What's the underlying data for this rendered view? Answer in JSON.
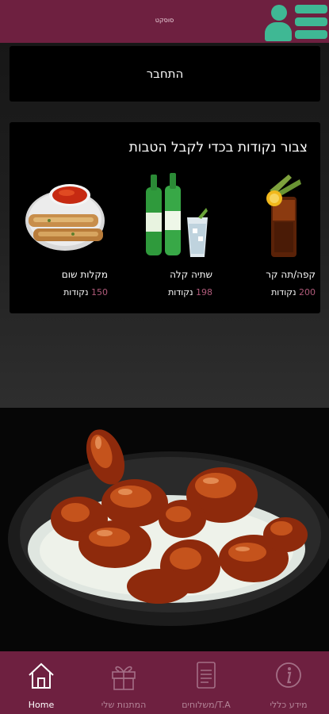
{
  "header": {
    "title": "סוסקט"
  },
  "login": {
    "label": "התחבר"
  },
  "rewards": {
    "title": "צבור נקודות בכדי לקבל הטבות",
    "items": [
      {
        "name": "מקלות שום",
        "points": "150",
        "unit": "נקודות"
      },
      {
        "name": "שתיה קלה",
        "points": "198",
        "unit": "נקודות"
      },
      {
        "name": "קפה/תה קר",
        "points": "200",
        "unit": "נקודות"
      }
    ]
  },
  "nav": {
    "tabs": [
      {
        "label": "Home",
        "icon": "home-icon"
      },
      {
        "label": "המתנות שלי",
        "icon": "gift-icon"
      },
      {
        "label": "משלוחים/T.A",
        "icon": "menu-icon"
      },
      {
        "label": "מידע כללי",
        "icon": "info-icon"
      }
    ]
  },
  "colors": {
    "brand": "#6e2040",
    "accent": "#3fb894",
    "points": "#b05a7a"
  }
}
